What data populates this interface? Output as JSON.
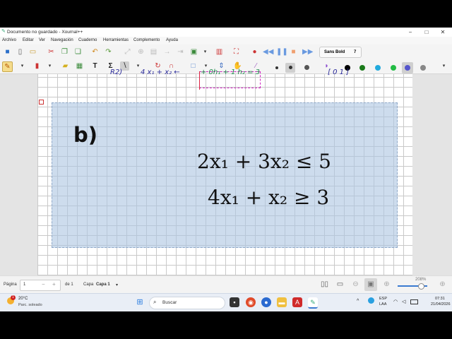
{
  "window": {
    "title": "Documento no guardado - Xournal++",
    "minimize": "−",
    "maximize": "□",
    "close": "✕"
  },
  "menubar": {
    "items": [
      "Archivo",
      "Editar",
      "Ver",
      "Navegación",
      "Cuaderno",
      "Herramientas",
      "Complemento",
      "Ayuda"
    ]
  },
  "toolbar": {
    "font_name": "Sans Bold",
    "font_size": "7",
    "colors": [
      "#000000",
      "#1a7a1a",
      "#22aadd",
      "#22bb44",
      "#5555cc",
      "#888888"
    ],
    "selected_color": "#5555cc"
  },
  "canvas": {
    "label_b": "b)",
    "eq1": "2x₁ + 3x₂ ≤ 5",
    "eq2": "4x₁ + x₂ ≥ 3",
    "handwriting_r2": "R2)",
    "handwriting_expr": "4 x₁  +  x₂  ←",
    "handwriting_plus": "+  0h₁  +  1 h₂  =  3",
    "handwriting_matrix": "[ 0    1 ]"
  },
  "statusbar": {
    "page_label": "Página",
    "page_value": "1",
    "of_label": "de 1",
    "layer_label": "Capa",
    "layer_value": "Capa 1",
    "zoom": "208%"
  },
  "taskbar": {
    "weather_temp": "20°C",
    "weather_desc": "Parc. soleado",
    "search_placeholder": "Buscar",
    "lang": "ESP",
    "lang_sub": "LAA",
    "time": "07:31",
    "date": "21/04/2026",
    "weather_badge": "1"
  }
}
